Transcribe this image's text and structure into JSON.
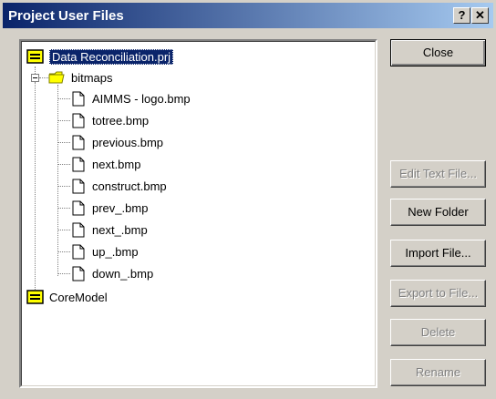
{
  "window": {
    "title": "Project User Files",
    "help_glyph": "?",
    "close_glyph": "✕"
  },
  "tree": {
    "root": {
      "label": "Data Reconciliation.prj"
    },
    "folder": {
      "label": "bitmaps"
    },
    "files": [
      "AIMMS - logo.bmp",
      "totree.bmp",
      "previous.bmp",
      "next.bmp",
      "construct.bmp",
      "prev_.bmp",
      "next_.bmp",
      "up_.bmp",
      "down_.bmp"
    ],
    "second": {
      "label": "CoreModel"
    }
  },
  "buttons": {
    "close": "Close",
    "edit_text": "Edit Text File...",
    "new_folder": "New Folder",
    "import": "Import File...",
    "export": "Export to File...",
    "delete": "Delete",
    "rename": "Rename"
  },
  "colors": {
    "selection": "#0a246a",
    "title_start": "#0a246a",
    "title_end": "#a6caf0",
    "folder": "#ffff00"
  }
}
